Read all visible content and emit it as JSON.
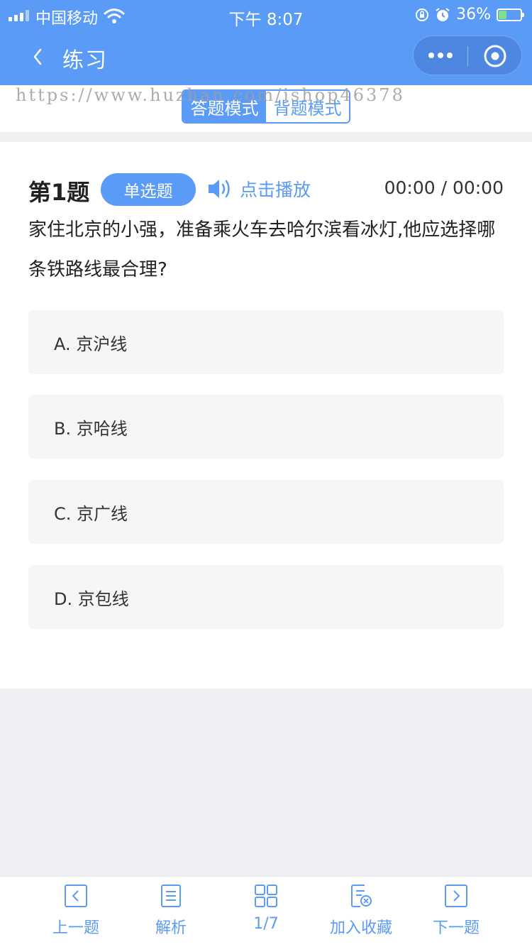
{
  "status_bar": {
    "carrier": "中国移动",
    "time": "下午 8:07",
    "battery": "36%",
    "battery_level": 0.36
  },
  "nav": {
    "title": "练习"
  },
  "watermark": "https://www.huzhan.com/ishop46378",
  "mode_switch": {
    "answer_mode": "答题模式",
    "recite_mode": "背题模式"
  },
  "question": {
    "number": "第1题",
    "type": "单选题",
    "play_label": "点击播放",
    "audio_time": "00:00 / 00:00",
    "text": "家住北京的小强，准备乘火车去哈尔滨看冰灯,他应选择哪条铁路线最合理?",
    "options": [
      {
        "label": "A. 京沪线"
      },
      {
        "label": "B. 京哈线"
      },
      {
        "label": "C. 京广线"
      },
      {
        "label": "D. 京包线"
      }
    ]
  },
  "toolbar": {
    "prev": "上一题",
    "analysis": "解析",
    "progress": "1/7",
    "favorite": "加入收藏",
    "next": "下一题"
  },
  "colors": {
    "primary": "#5b9bf8",
    "background": "#eeeff3",
    "option_bg": "#f5f6f8"
  }
}
